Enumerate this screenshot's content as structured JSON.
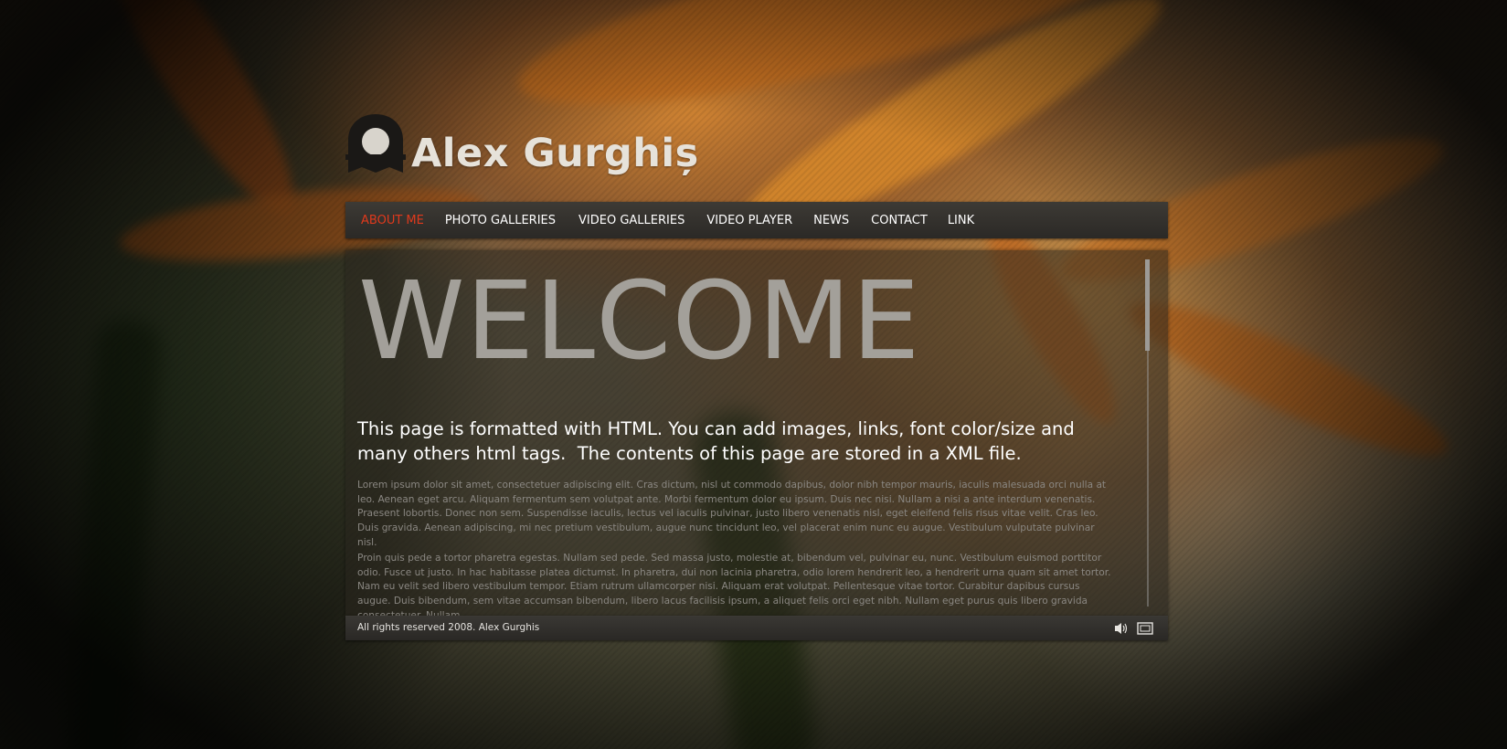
{
  "site": {
    "title": "Alex Gurghiș"
  },
  "nav": {
    "items": [
      {
        "label": "ABOUT ME",
        "active": true
      },
      {
        "label": "PHOTO GALLERIES",
        "active": false
      },
      {
        "label": "VIDEO GALLERIES",
        "active": false
      },
      {
        "label": "VIDEO PLAYER",
        "active": false
      },
      {
        "label": "NEWS",
        "active": false
      },
      {
        "label": "CONTACT",
        "active": false
      },
      {
        "label": "LINK",
        "active": false
      }
    ]
  },
  "content": {
    "heading": "WELCOME",
    "intro": "This page is formatted with HTML. You can add images, links, font color/size and many others html tags.  The contents of this page are stored in a XML file.",
    "paragraph1": "Lorem ipsum dolor sit amet, consectetuer adipiscing elit. Cras dictum, nisl ut commodo dapibus, dolor nibh tempor mauris, iaculis malesuada orci nulla at leo. Aenean eget arcu. Aliquam fermentum sem volutpat ante. Morbi fermentum dolor eu ipsum. Duis nec nisi. Nullam a nisi a ante interdum venenatis. Praesent lobortis. Donec non sem. Suspendisse iaculis, lectus vel iaculis pulvinar, justo libero venenatis nisl, eget eleifend felis risus vitae velit. Cras leo. Duis gravida. Aenean adipiscing, mi nec pretium vestibulum, augue nunc tincidunt leo, vel placerat enim nunc eu augue. Vestibulum vulputate pulvinar nisl.",
    "paragraph2": "Proin quis pede a tortor pharetra egestas. Nullam sed pede. Sed massa justo, molestie at, bibendum vel, pulvinar eu, nunc. Vestibulum euismod porttitor odio. Fusce ut justo. In hac habitasse platea dictumst. In pharetra, dui non lacinia pharetra, odio lorem hendrerit leo, a hendrerit urna quam sit amet tortor. Nam eu velit sed libero vestibulum tempor. Etiam rutrum ullamcorper nisi. Aliquam erat volutpat. Pellentesque vitae tortor. Curabitur dapibus cursus augue. Duis bibendum, sem vitae accumsan bibendum, libero lacus facilisis ipsum, a aliquet felis orci eget nibh. Nullam eget purus quis libero gravida consectetuer. Nullam"
  },
  "footer": {
    "copyright": "All rights reserved 2008. Alex Gurghis"
  },
  "icons": {
    "logo": "camera-logo-icon",
    "sound": "speaker-icon",
    "fullscreen": "fullscreen-icon"
  },
  "colors": {
    "nav_active": "#e0391c",
    "nav_text": "#ffffff",
    "heading": "#a3a09a",
    "body_text": "#8a8782"
  }
}
